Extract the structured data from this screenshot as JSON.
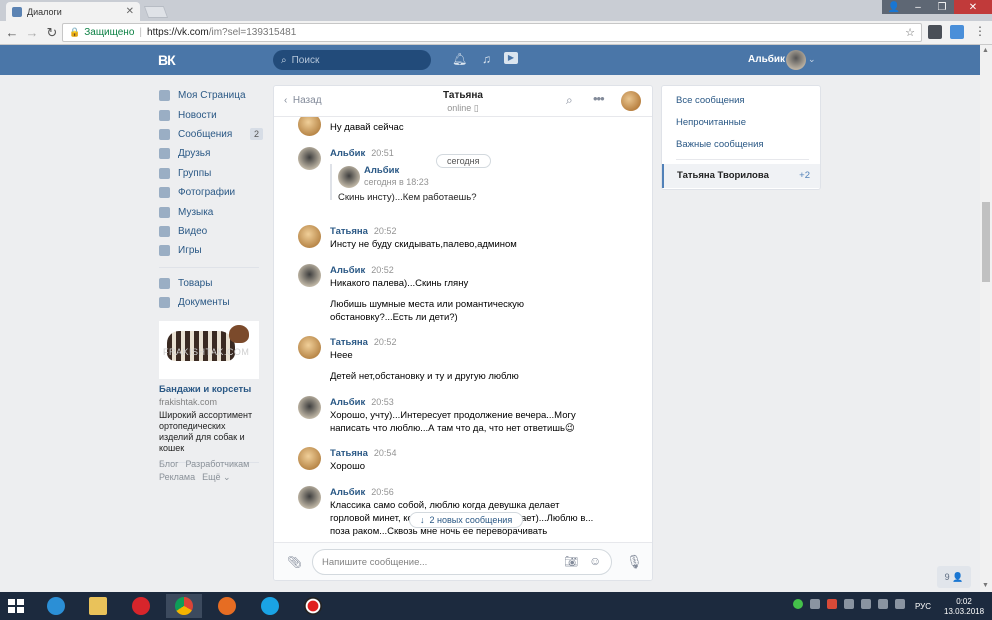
{
  "browser": {
    "tab_title": "Диалоги",
    "secure_label": "Защищено",
    "url_base": "https://vk.com",
    "url_path": "/im?sel=139315481"
  },
  "header": {
    "logo": "ВК",
    "search_placeholder": "Поиск",
    "user_name": "Альбик"
  },
  "sidebar": {
    "items": [
      {
        "label": "Моя Страница",
        "count": ""
      },
      {
        "label": "Новости",
        "count": ""
      },
      {
        "label": "Сообщения",
        "count": "2"
      },
      {
        "label": "Друзья",
        "count": ""
      },
      {
        "label": "Группы",
        "count": ""
      },
      {
        "label": "Фотографии",
        "count": ""
      },
      {
        "label": "Музыка",
        "count": ""
      },
      {
        "label": "Видео",
        "count": ""
      },
      {
        "label": "Игры",
        "count": ""
      }
    ],
    "items2": [
      {
        "label": "Товары"
      },
      {
        "label": "Документы"
      }
    ]
  },
  "ad": {
    "watermark": "FRAKISHTAK.COM",
    "title": "Бандажи и корсеты",
    "url": "frakishtak.com",
    "desc": "Широкий ассортимент ортопедических изделий для собак и кошек"
  },
  "footer": {
    "blog": "Блог",
    "dev": "Разработчикам",
    "ads": "Реклама",
    "more": "Ещё ⌄"
  },
  "chat": {
    "back": "Назад",
    "title": "Татьяна",
    "status": "online ▯",
    "date_divider": "сегодня",
    "new_messages": "2 новых сообщения",
    "input_placeholder": "Напишите сообщение...",
    "messages": [
      {
        "text": "Ну давай сейчас"
      },
      {
        "name": "Альбик",
        "time": "20:51",
        "fwd_name": "Альбик",
        "fwd_time": "сегодня в 18:23",
        "fwd_text": "Скинь инсту)...Кем работаешь?"
      },
      {
        "name": "Татьяна",
        "time": "20:52",
        "text": "Инсту не буду скидывать,палево,админом"
      },
      {
        "name": "Альбик",
        "time": "20:52",
        "text": "Никакого палева)...Скинь гляну",
        "text2": "Любишь шумные места или романтическую обстановку?...Есть ли дети?)"
      },
      {
        "name": "Татьяна",
        "time": "20:52",
        "text": "Нееe",
        "text2": "Детей нет,обстановку и ту и другую люблю"
      },
      {
        "name": "Альбик",
        "time": "20:53",
        "text": "Хорошо, учту)...Интересует продолжение вечера...Могу написать что люблю...А там что да, что нет ответишь😉"
      },
      {
        "name": "Татьяна",
        "time": "20:54",
        "text": "Хорошо"
      },
      {
        "name": "Альбик",
        "time": "20:56",
        "text": "Классика само собой, люблю когда девушка делает горловой минет, кончать в р...                        но когда глотает)...Люблю в...                        поза раком...Сквозь мне ночь ее переворачивать"
      }
    ]
  },
  "right": {
    "all": "Все сообщения",
    "unread": "Непрочитанные",
    "important": "Важные сообщения",
    "conv_name": "Татьяна Творилова",
    "conv_count": "+2"
  },
  "friends_count": "9 👤",
  "taskbar": {
    "lang": "РУС",
    "time": "0:02",
    "date": "13.03.2018"
  },
  "colors": {
    "vk_blue": "#4a76a8",
    "link": "#2a5885",
    "taskbar": "#1c2a3e"
  }
}
